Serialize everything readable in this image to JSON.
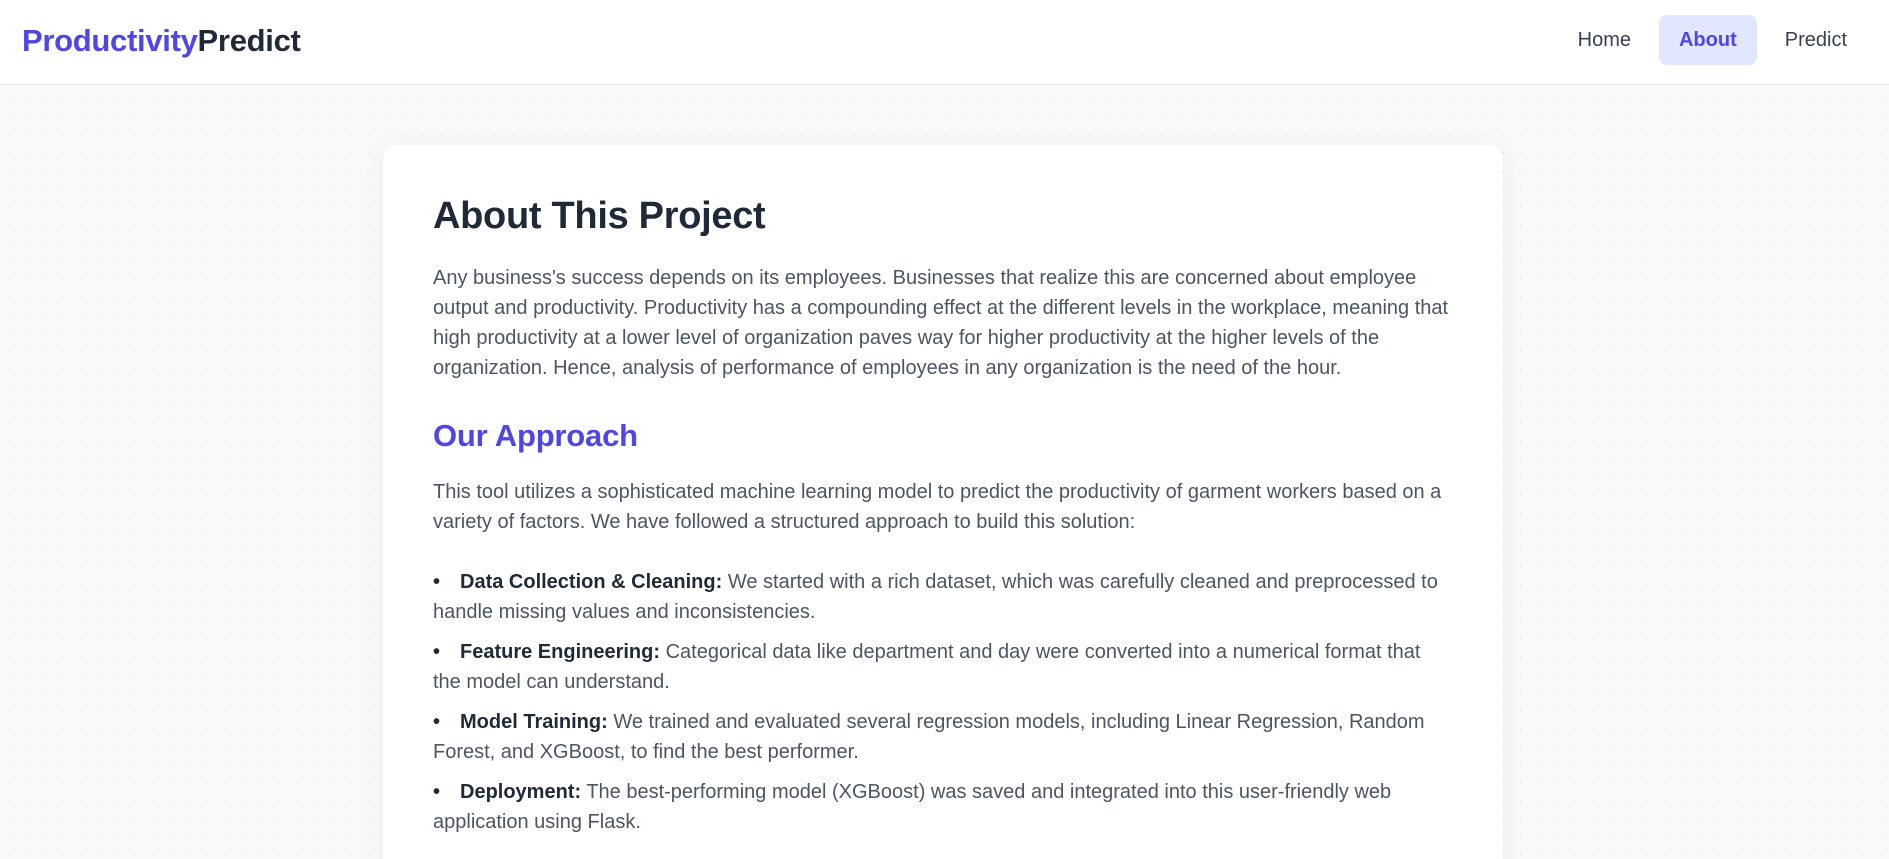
{
  "header": {
    "brand_primary": "Productivity",
    "brand_secondary": "Predict",
    "nav": [
      {
        "label": "Home",
        "active": false
      },
      {
        "label": "About",
        "active": true
      },
      {
        "label": "Predict",
        "active": false
      }
    ]
  },
  "main": {
    "title": "About This Project",
    "intro": "Any business's success depends on its employees. Businesses that realize this are concerned about employee output and productivity. Productivity has a compounding effect at the different levels in the workplace, meaning that high productivity at a lower level of organization paves way for higher productivity at the higher levels of the organization. Hence, analysis of performance of employees in any organization is the need of the hour.",
    "approach_title": "Our Approach",
    "approach_intro": "This tool utilizes a sophisticated machine learning model to predict the productivity of garment workers based on a variety of factors. We have followed a structured approach to build this solution:",
    "steps": [
      {
        "title": "Data Collection & Cleaning:",
        "text": "We started with a rich dataset, which was carefully cleaned and preprocessed to handle missing values and inconsistencies."
      },
      {
        "title": "Feature Engineering:",
        "text": "Categorical data like department and day were converted into a numerical format that the model can understand."
      },
      {
        "title": "Model Training:",
        "text": "We trained and evaluated several regression models, including Linear Regression, Random Forest, and XGBoost, to find the best performer."
      },
      {
        "title": "Deployment:",
        "text": "The best-performing model (XGBoost) was saved and integrated into this user-friendly web application using Flask."
      }
    ]
  },
  "colors": {
    "accent": "#4f46e5",
    "accent_bg": "#e0e7ff",
    "heading": "#1f2937",
    "body_text": "#4b5563"
  }
}
